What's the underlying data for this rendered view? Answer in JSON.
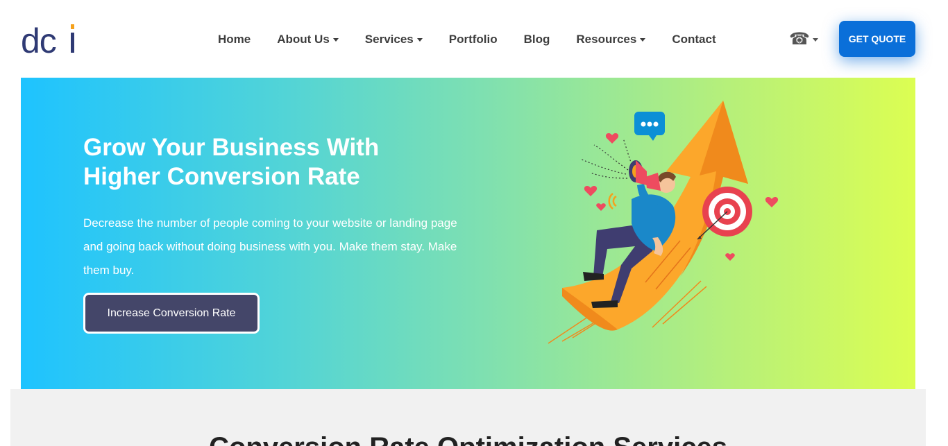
{
  "header": {
    "logo_text": "dci",
    "nav": [
      {
        "label": "Home",
        "has_dropdown": false
      },
      {
        "label": "About Us",
        "has_dropdown": true
      },
      {
        "label": "Services",
        "has_dropdown": true
      },
      {
        "label": "Portfolio",
        "has_dropdown": false
      },
      {
        "label": "Blog",
        "has_dropdown": false
      },
      {
        "label": "Resources",
        "has_dropdown": true
      },
      {
        "label": "Contact",
        "has_dropdown": false
      }
    ],
    "phone_icon": "☎",
    "quote_label": "GET QUOTE"
  },
  "hero": {
    "title": "Grow Your Business With Higher Conversion Rate",
    "description": "Decrease the number of people coming to your website or landing page and going back without doing business with you. Make them stay. Make them buy.",
    "button_label": "Increase Conversion Rate",
    "illustration": "megaphone-man-on-rising-arrow-illustration"
  },
  "section": {
    "title": "Conversion Rate Optimization Services"
  },
  "colors": {
    "brand_blue": "#0a6fd9",
    "logo_navy": "#2f3a74",
    "logo_orange": "#f5a11c",
    "gradient_start": "#1ec3ff",
    "gradient_end": "#dcfe52",
    "hero_button": "#444669"
  }
}
